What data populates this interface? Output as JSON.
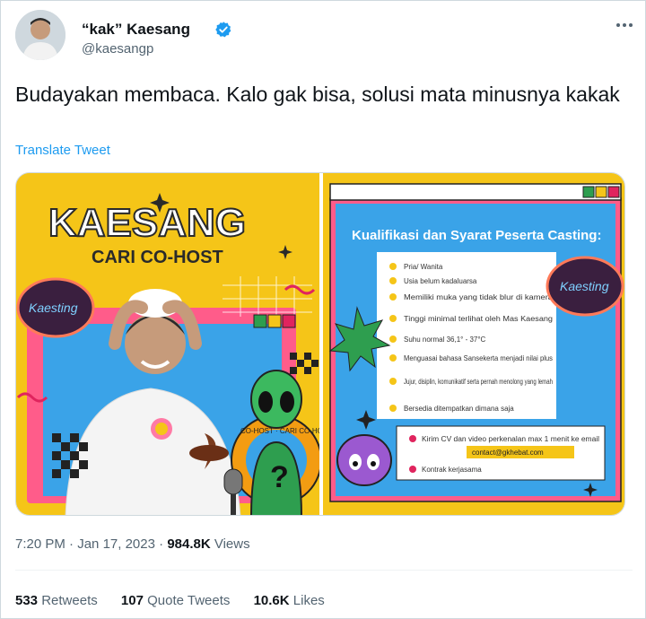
{
  "author": {
    "display_name": "“kak” Kaesang",
    "handle": "@kaesangp"
  },
  "tweet": {
    "text": "Budayakan membaca. Kalo gak bisa, solusi mata minusnya kakak",
    "translate_label": "Translate Tweet"
  },
  "media_left": {
    "title": "KAESANG",
    "subtitle": "CARI CO-HOST",
    "logo_text": "Kaesting",
    "ring_text": "CO-HOST · CARI CO-HOST · CARI"
  },
  "media_right": {
    "heading": "Kualifikasi dan Syarat Peserta Casting:",
    "items": [
      "Pria/ Wanita",
      "Usia belum kadaluarsa",
      "Memiliki muka yang tidak blur di kamera",
      "Tinggi minimal terlihat oleh Mas Kaesang",
      "Suhu normal 36,1° - 37°C",
      "Menguasai bahasa Sansekerta menjadi nilai plus",
      "Jujur, disiplin, komunikatif serta pernah menolong yang lemah",
      "Bersedia ditempatkan dimana saja"
    ],
    "contact_lines": [
      "Kirim CV dan video perkenalan max 1 menit ke email",
      "contact@gkhebat.com",
      "Kontrak kerjasama"
    ]
  },
  "meta": {
    "time": "7:20 PM",
    "date": "Jan 17, 2023",
    "views_count": "984.8K",
    "views_label": "Views"
  },
  "stats": {
    "retweets_count": "533",
    "retweets_label": "Retweets",
    "quotes_count": "107",
    "quotes_label": "Quote Tweets",
    "likes_count": "10.6K",
    "likes_label": "Likes"
  },
  "colors": {
    "brand_blue": "#1d9bf0",
    "poster_yellow": "#f5c518",
    "poster_blue": "#3aa3e8",
    "poster_pink": "#ff5c8a",
    "accent_red": "#e0245e"
  },
  "icons": {
    "verified": "verified-badge-icon",
    "more": "more-horizontal-icon"
  }
}
